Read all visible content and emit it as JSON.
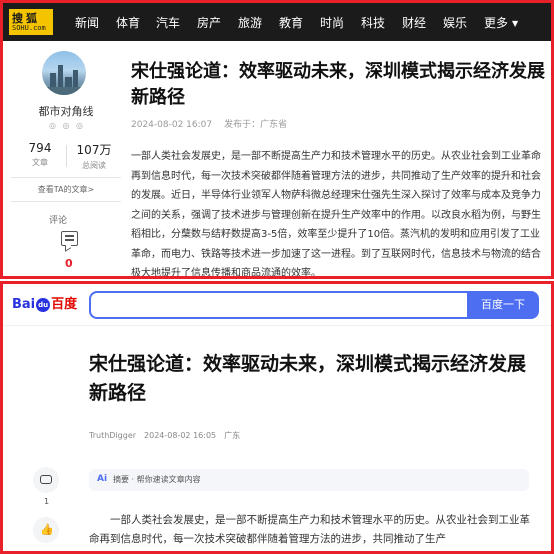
{
  "sohu": {
    "logo_top": "搜狐",
    "logo_bottom": "SOHU.com",
    "nav": [
      "新闻",
      "体育",
      "汽车",
      "房产",
      "旅游",
      "教育",
      "时尚",
      "科技",
      "财经",
      "娱乐",
      "更多"
    ],
    "author": "都市对角线",
    "badges": "◎ ◎ ◎",
    "stats": [
      {
        "num": "794",
        "label": "文章"
      },
      {
        "num": "107万",
        "label": "总阅读"
      }
    ],
    "view_articles": "查看TA的文章>",
    "comment_label": "评论",
    "comment_count": "0",
    "title": "宋仕强论道：效率驱动未来，深圳模式揭示经济发展新路径",
    "date": "2024-08-02 16:07",
    "location": "发布于：广东省",
    "body": "一部人类社会发展史，是一部不断提高生产力和技术管理水平的历史。从农业社会到工业革命再到信息时代，每一次技术突破都伴随着管理方法的进步，共同推动了生产效率的提升和社会的发展。近日，半导体行业领军人物萨科微总经理宋仕强先生深入探讨了效率与成本及竞争力之间的关系，强调了技术进步与管理创新在提升生产效率中的作用。以改良水稻为例，与野生稻相比，分蘖数与结籽数提高3-5倍，效率至少提升了10倍。蒸汽机的发明和应用引发了工业革命，而电力、铁路等技术进一步加速了这一进程。到了互联网时代，信息技术与物流的结合极大地提升了信息传播和商品流通的效率。"
  },
  "baidu": {
    "logo_bai": "Bai",
    "logo_paw": "du",
    "logo_baidu": "百度",
    "search_value": "",
    "search_button": "百度一下",
    "title": "宋仕强论道：效率驱动未来，深圳模式揭示经济发展新路径",
    "author": "TruthDigger",
    "date": "2024-08-02 16:05",
    "location": "广东",
    "comment_count": "1",
    "summary_ai": "Ai",
    "summary_text": "摘要 · 帮你速读文章内容",
    "body": "一部人类社会发展史，是一部不断提高生产力和技术管理水平的历史。从农业社会到工业革命再到信息时代，每一次技术突破都伴随着管理方法的进步，共同推动了生产"
  },
  "colors": {
    "accent_red": "#e8202a",
    "baidu_blue": "#4e6ef2",
    "sohu_yellow": "#f5c400"
  },
  "icons": [
    "comment-icon",
    "thumbs-up-icon",
    "search-icon"
  ]
}
